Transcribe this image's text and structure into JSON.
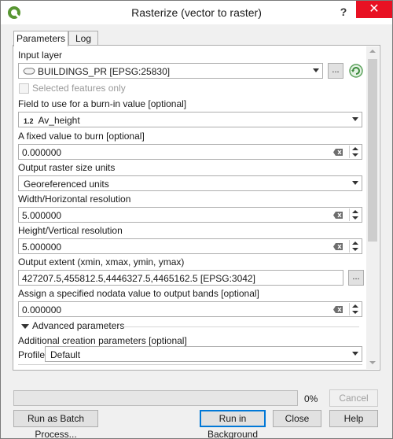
{
  "window": {
    "title": "Rasterize (vector to raster)",
    "help": "?",
    "close": "✕"
  },
  "tabs": [
    {
      "label": "Parameters",
      "active": true
    },
    {
      "label": "Log",
      "active": false
    }
  ],
  "params": {
    "input_layer_label": "Input layer",
    "input_layer_value": "BUILDINGS_PR [EPSG:25830]",
    "selected_only_label": "Selected features only",
    "burn_field_label": "Field to use for a burn-in value [optional]",
    "burn_field_type": "1.2",
    "burn_field_value": "Av_height",
    "fixed_value_label": "A fixed value to burn [optional]",
    "fixed_value": "0.000000",
    "units_label": "Output raster size units",
    "units_value": "Georeferenced units",
    "width_label": "Width/Horizontal resolution",
    "width_value": "5.000000",
    "height_label": "Height/Vertical resolution",
    "height_value": "5.000000",
    "extent_label": "Output extent (xmin, xmax, ymin, ymax)",
    "extent_value": "427207.5,455812.5,4446327.5,4465162.5 [EPSG:3042]",
    "nodata_label": "Assign a specified nodata value to output bands [optional]",
    "nodata_value": "0.000000",
    "advanced_label": "Advanced parameters",
    "creation_label": "Additional creation parameters [optional]",
    "profile_label": "Profile",
    "profile_value": "Default",
    "ellipsis": "..."
  },
  "footer": {
    "progress_percent": 0,
    "progress_text": "0%",
    "cancel": "Cancel",
    "batch": "Run as Batch Process...",
    "run_bg": "Run in Background",
    "close": "Close",
    "help": "Help"
  },
  "colors": {
    "accent": "#0078d7",
    "close_red": "#e81123",
    "qgis_green": "#589632"
  }
}
